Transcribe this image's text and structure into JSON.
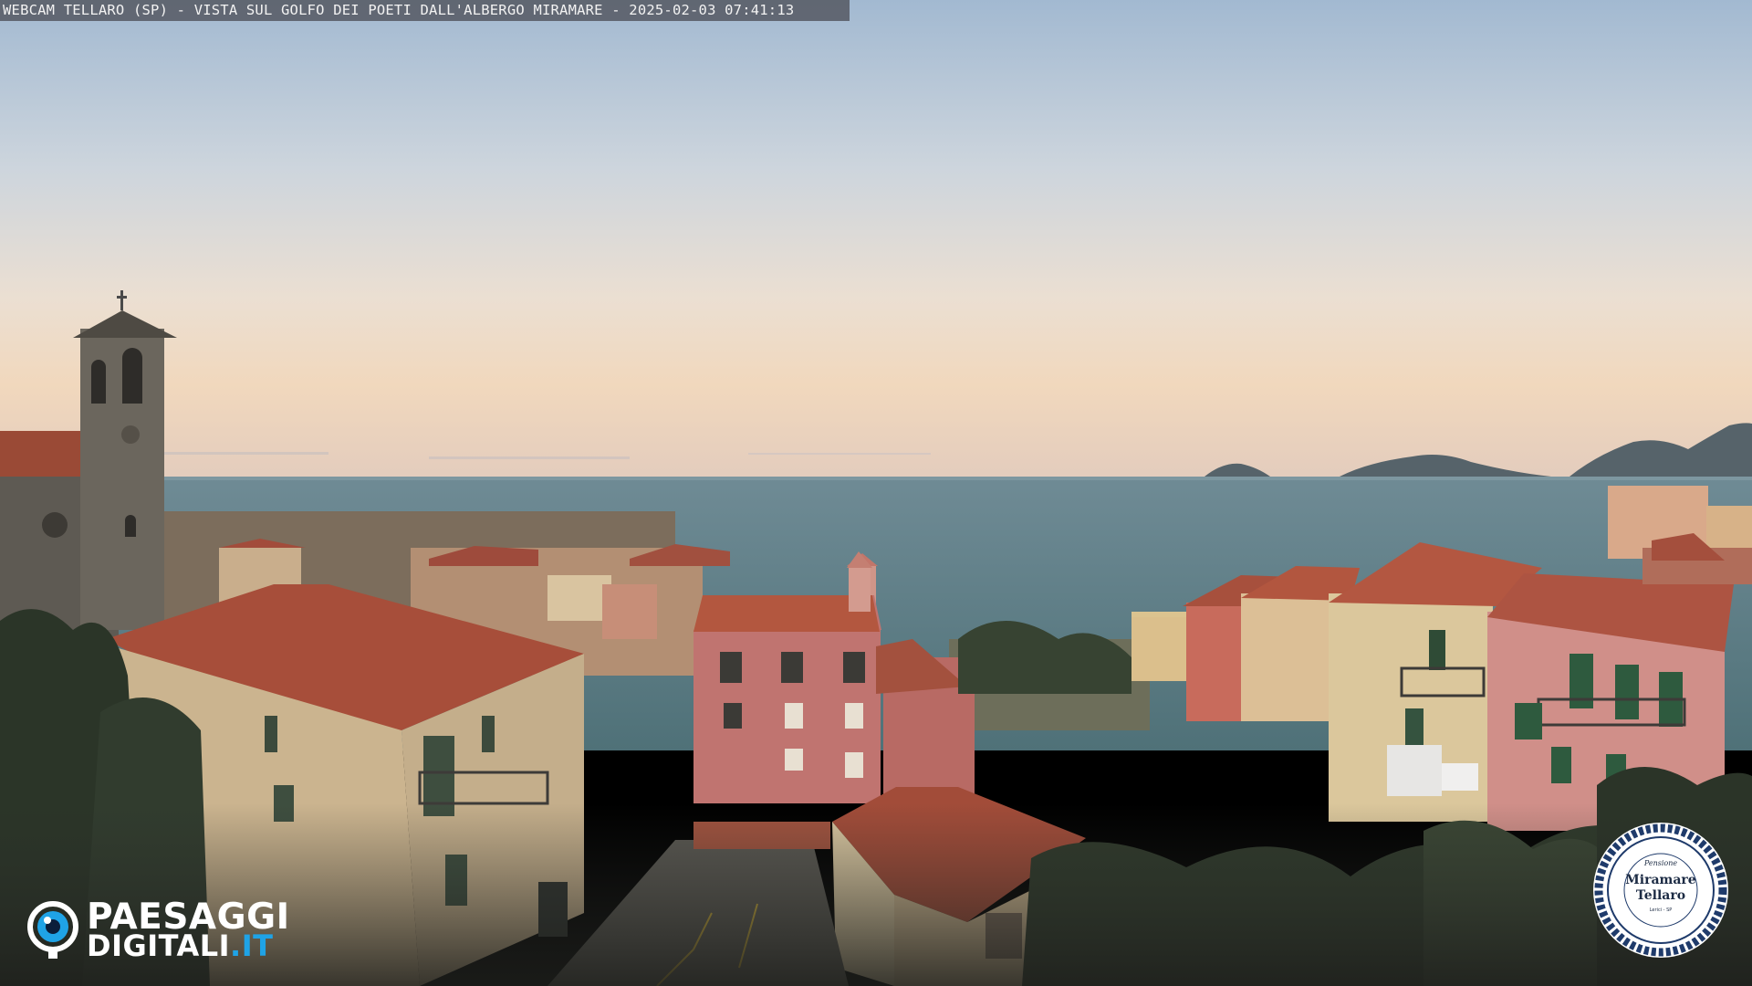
{
  "caption": {
    "text": "WEBCAM TELLARO (SP) - VISTA SUL GOLFO DEI POETI DALL'ALBERGO MIRAMARE - 2025-02-03 07:41:13"
  },
  "watermark": {
    "line1": "PAESAGGI",
    "line2_main": "DIGITALI",
    "line2_tld": ".IT",
    "accent": "#1fa3e6",
    "icon": "eye-icon"
  },
  "badge": {
    "small": "Pensione",
    "name_line1": "Miramare",
    "name_line2": "Tellaro",
    "tiny": "Lerici - SP",
    "ring_color": "#1f3b6b"
  },
  "scene_palette": {
    "sky_top": "#9fb6cf",
    "sky_mid": "#d9d9dc",
    "sky_horizon": "#f1d8bd",
    "sea": "#5c7f86",
    "roof": "#b5533f",
    "facade_pink": "#c97a76",
    "facade_cream": "#d7c49c",
    "stone": "#5a564f"
  }
}
